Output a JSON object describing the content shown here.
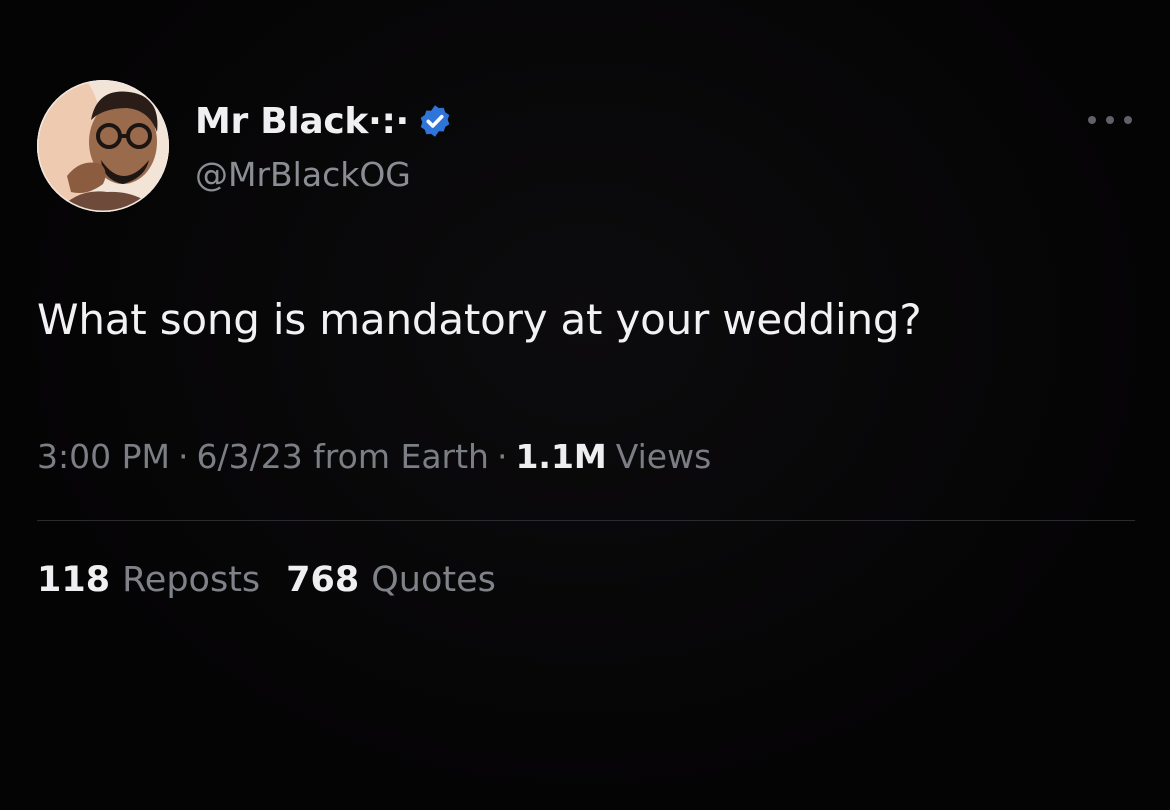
{
  "author": {
    "display_name": "Mr Black·:·",
    "handle": "@MrBlackOG",
    "verified": true,
    "verified_color": "#1d9bf0"
  },
  "tweet": {
    "text": "What song is mandatory at your wedding?",
    "time": "3:00 PM",
    "date": "6/3/23 from Earth",
    "separator": "·",
    "views_count": "1.1M",
    "views_label": "Views"
  },
  "stats": {
    "reposts_count": "118",
    "reposts_label": "Reposts",
    "quotes_count": "768",
    "quotes_label": "Quotes"
  },
  "icons": {
    "more": "more-horizontal-icon",
    "verified": "verified-badge-icon"
  },
  "theme": {
    "background": "#050405",
    "text_primary": "#f2f2f4",
    "text_secondary": "#7b7e84"
  }
}
